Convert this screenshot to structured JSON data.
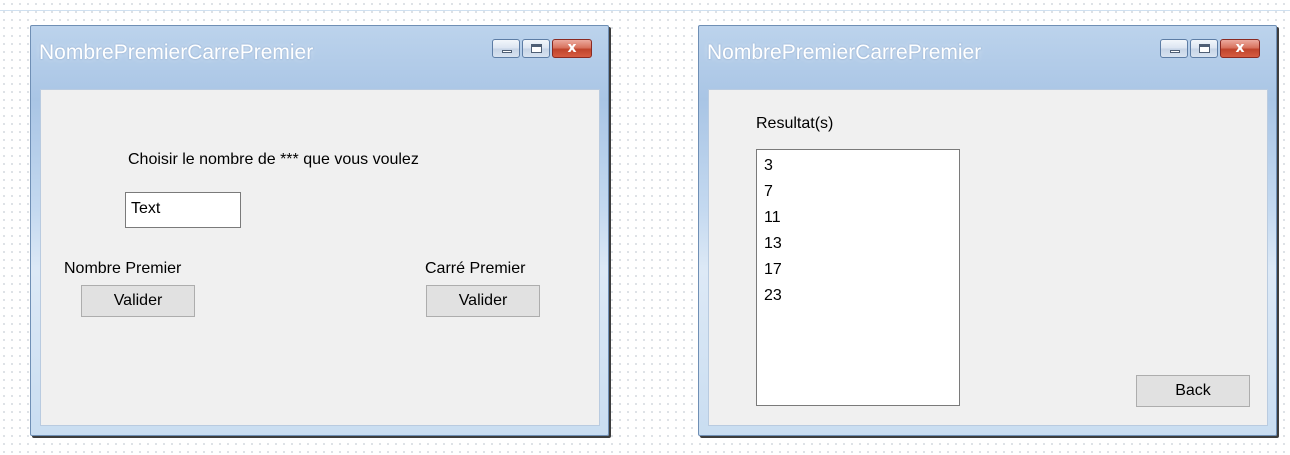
{
  "left_window": {
    "title": "NombrePremierCarrePremier",
    "prompt_label": "Choisir le nombre de *** que vous voulez",
    "text_input_value": "Text",
    "nombre_premier_label": "Nombre Premier",
    "nombre_premier_button": "Valider",
    "carre_premier_label": "Carré Premier",
    "carre_premier_button": "Valider",
    "close_glyph": "x"
  },
  "right_window": {
    "title": "NombrePremierCarrePremier",
    "results_label": "Resultat(s)",
    "results": [
      "3",
      "7",
      "11",
      "13",
      "17",
      "23"
    ],
    "back_button": "Back",
    "close_glyph": "x"
  }
}
